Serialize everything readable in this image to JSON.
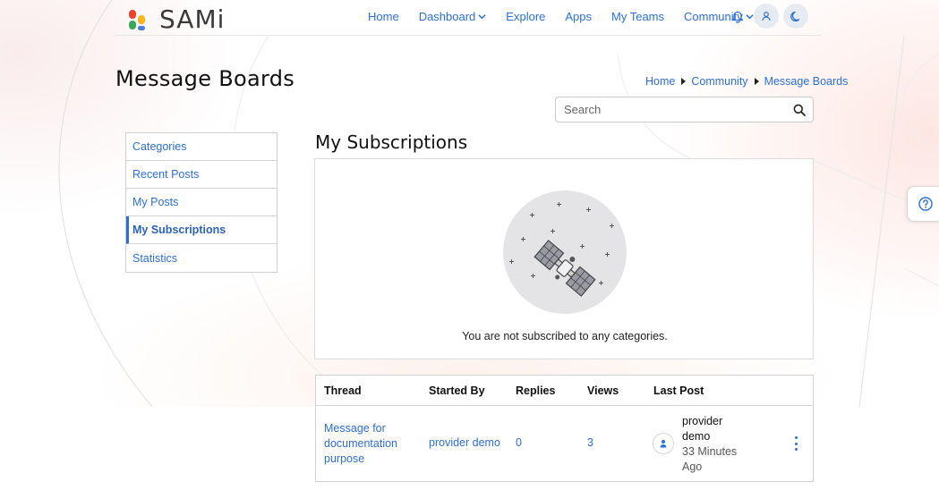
{
  "brand": {
    "name": "SAMi"
  },
  "nav": {
    "items": [
      {
        "label": "Home",
        "dropdown": false
      },
      {
        "label": "Dashboard",
        "dropdown": true
      },
      {
        "label": "Explore",
        "dropdown": false
      },
      {
        "label": "Apps",
        "dropdown": false
      },
      {
        "label": "My Teams",
        "dropdown": false
      },
      {
        "label": "Community",
        "dropdown": true
      }
    ],
    "icons": [
      "bell-icon",
      "user-icon",
      "moon-icon"
    ]
  },
  "page": {
    "title": "Message Boards"
  },
  "breadcrumb": [
    "Home",
    "Community",
    "Message Boards"
  ],
  "search": {
    "placeholder": "Search"
  },
  "sidebar": {
    "items": [
      {
        "label": "Categories",
        "active": false
      },
      {
        "label": "Recent Posts",
        "active": false
      },
      {
        "label": "My Posts",
        "active": false
      },
      {
        "label": "My Subscriptions",
        "active": true
      },
      {
        "label": "Statistics",
        "active": false
      }
    ]
  },
  "main": {
    "section_title": "My Subscriptions",
    "empty_message": "You are not subscribed to any categories."
  },
  "table": {
    "headers": [
      "Thread",
      "Started By",
      "Replies",
      "Views",
      "Last Post"
    ],
    "rows": [
      {
        "thread": "Message for documentation purpose",
        "started_by": "provider demo",
        "replies": "0",
        "views": "3",
        "last_post_user": "provider demo",
        "last_post_time": "33 Minutes Ago"
      }
    ]
  },
  "colors": {
    "accent": "#2d6fd1",
    "text": "#222222",
    "border": "#d0d0d0"
  }
}
